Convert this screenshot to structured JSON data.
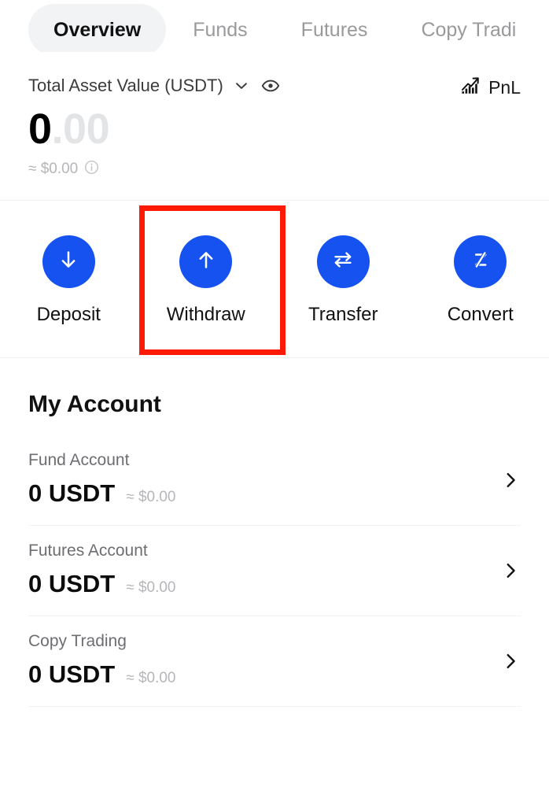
{
  "tabs": [
    {
      "label": "Overview",
      "active": true
    },
    {
      "label": "Funds",
      "active": false
    },
    {
      "label": "Futures",
      "active": false
    },
    {
      "label": "Copy Tradi",
      "active": false
    }
  ],
  "asset": {
    "label": "Total Asset Value (USDT)",
    "chevron_icon": "chevron-down-icon",
    "eye_icon": "eye-visible-icon",
    "pnl_label": "PnL",
    "pnl_icon": "chart-growth-icon",
    "amount_integer": "0",
    "amount_decimal": ".00",
    "approx_value": "≈ $0.00",
    "info_icon": "info-circle-icon"
  },
  "actions": [
    {
      "label": "Deposit",
      "icon": "arrow-down-icon"
    },
    {
      "label": "Withdraw",
      "icon": "arrow-up-icon"
    },
    {
      "label": "Transfer",
      "icon": "transfer-arrows-icon"
    },
    {
      "label": "Convert",
      "icon": "convert-z-icon"
    }
  ],
  "highlight": {
    "target": "Withdraw",
    "color": "#ff1a05"
  },
  "my_account": {
    "title": "My Account",
    "rows": [
      {
        "name": "Fund Account",
        "amount": "0 USDT",
        "usd": "≈ $0.00",
        "chevron_icon": "chevron-right-icon"
      },
      {
        "name": "Futures Account",
        "amount": "0 USDT",
        "usd": "≈ $0.00",
        "chevron_icon": "chevron-right-icon"
      },
      {
        "name": "Copy Trading",
        "amount": "0 USDT",
        "usd": "≈ $0.00",
        "chevron_icon": "chevron-right-icon"
      }
    ]
  },
  "colors": {
    "accent_blue": "#1652f0",
    "highlight_red": "#ff1a05",
    "tab_active_bg": "#f2f3f5",
    "muted_text": "#b5b6b9"
  }
}
